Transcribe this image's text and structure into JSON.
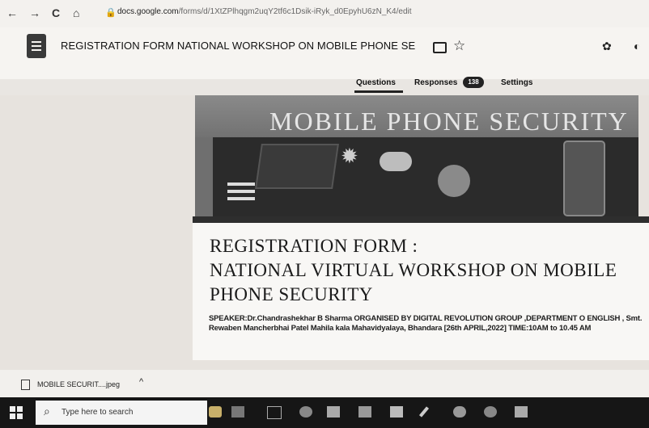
{
  "browser": {
    "url_host": "docs.google.com",
    "url_path": "/forms/d/1XtZPlhqgm2uqY2tf6c1Dsik-iRyk_d0EpyhU6zN_K4/edit",
    "back_icon": "←",
    "forward_icon": "→",
    "reload_icon": "C",
    "home_icon": "⌂"
  },
  "header": {
    "title": "REGISTRATION FORM  NATIONAL WORKSHOP ON MOBILE PHONE SE",
    "tabs": {
      "questions": "Questions",
      "responses": "Responses",
      "responses_count": "138",
      "settings": "Settings"
    }
  },
  "banner": {
    "text": "MOBILE PHONE SECURITY"
  },
  "form": {
    "title_line1": "REGISTRATION  FORM  :",
    "title_line2": "NATIONAL VIRTUAL WORKSHOP ON MOBILE",
    "title_line3": "PHONE SECURITY",
    "description": "SPEAKER:Dr.Chandrashekhar B Sharma ORGANISED BY  DIGITAL REVOLUTION GROUP ,DEPARTMENT O ENGLISH , Smt. Rewaben Mancherbhai Patel Mahila kala Mahavidyalaya, Bhandara [26th APRIL,2022] TIME:10AM to 10.45 AM"
  },
  "download": {
    "filename": "MOBILE SECURIT....jpeg",
    "chevron": "^"
  },
  "taskbar": {
    "search_placeholder": "Type here to search"
  }
}
